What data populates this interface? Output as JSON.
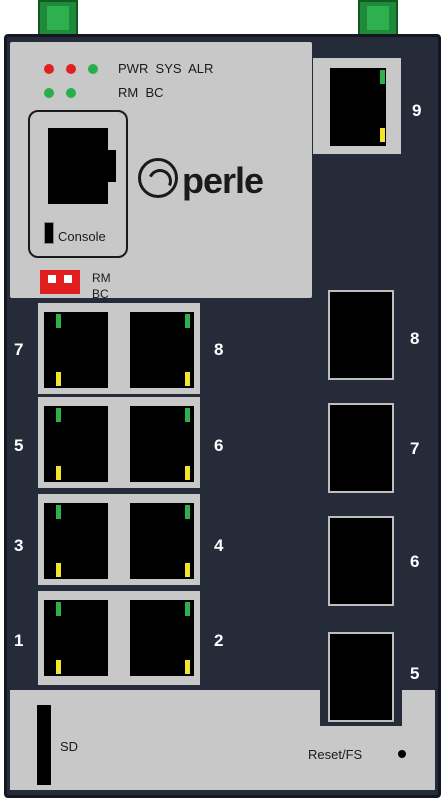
{
  "brand": {
    "logo_text": "perle"
  },
  "status": {
    "leds_row1": [
      {
        "color": "red"
      },
      {
        "color": "red"
      },
      {
        "color": "green"
      }
    ],
    "leds_row2": [
      {
        "color": "green"
      },
      {
        "color": "green"
      }
    ],
    "labels_row1": "PWR  SYS  ALR",
    "labels_row2": "RM  BC"
  },
  "console": {
    "label": "Console"
  },
  "dip_switch": {
    "label_1": "RM",
    "label_2": "BC"
  },
  "copper_ports": {
    "left_numbers": [
      "7",
      "5",
      "3",
      "1"
    ],
    "right_numbers": [
      "8",
      "6",
      "4",
      "2"
    ]
  },
  "uplink_rj45": {
    "number": "9"
  },
  "sfp_ports": [
    "8",
    "7",
    "6",
    "5"
  ],
  "bottom": {
    "sd_label": "SD",
    "reset_label": "Reset/FS"
  },
  "colors": {
    "chassis": "#262b3a",
    "panel": "#c8c8c8",
    "led_red": "#e12020",
    "led_green": "#27b04a",
    "link_led": "#2fb04e",
    "act_led": "#f2e52a",
    "antenna": "#1f8a3a"
  }
}
